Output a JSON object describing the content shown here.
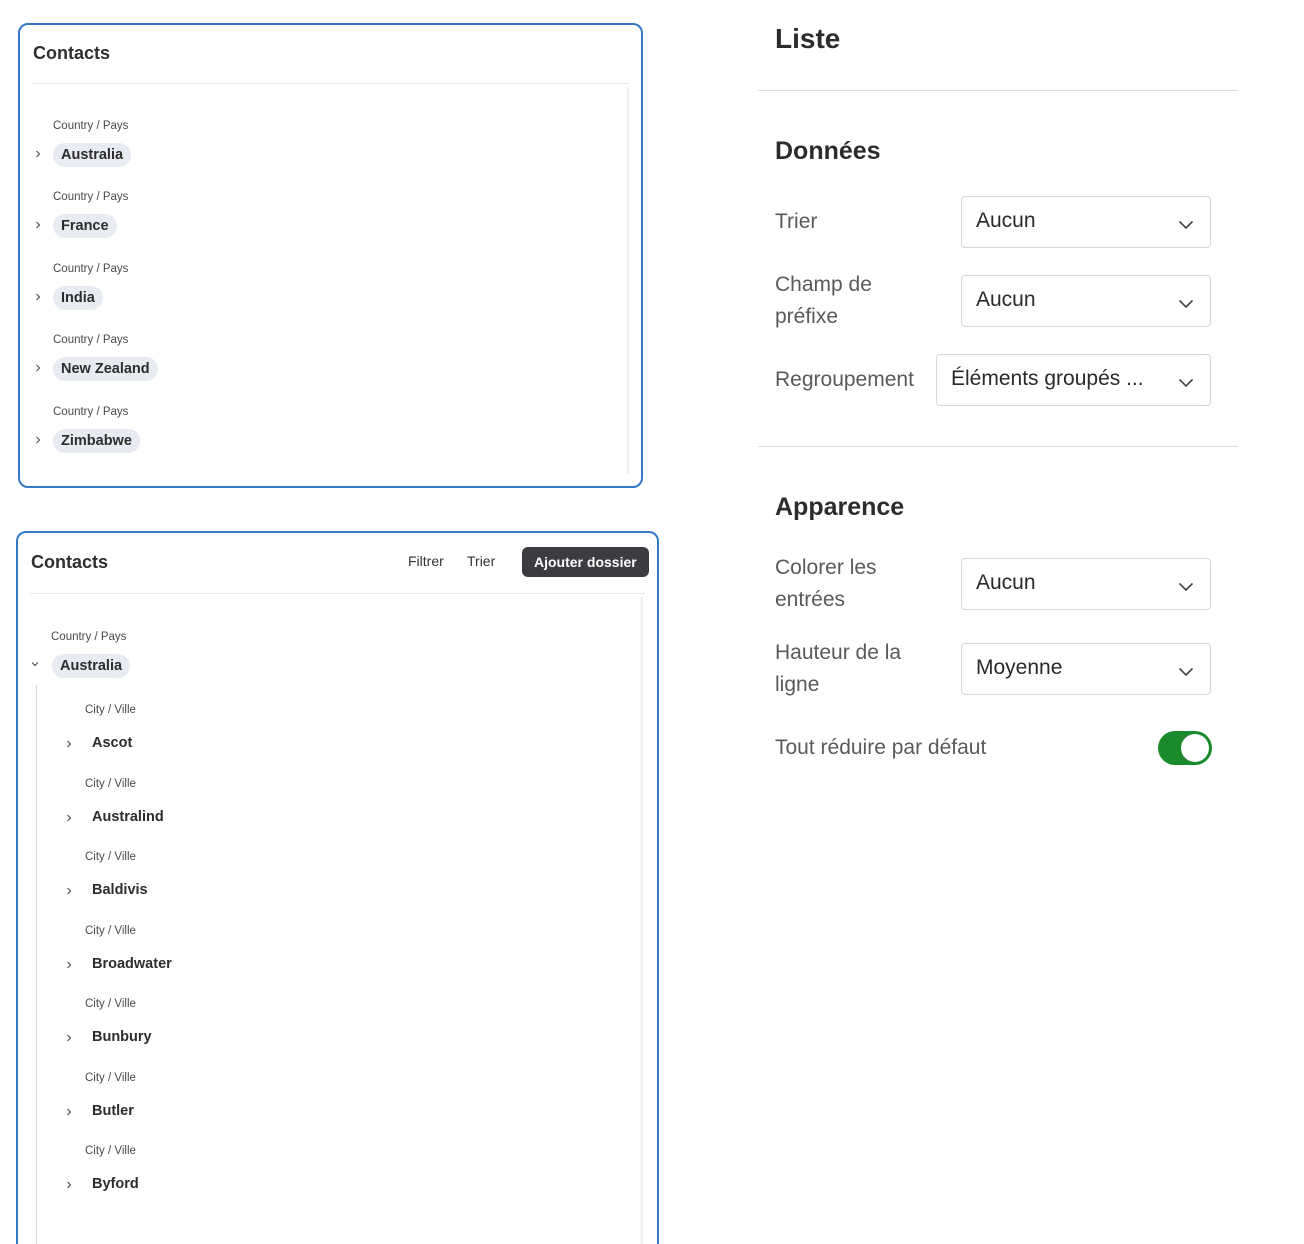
{
  "card_top": {
    "title": "Contacts",
    "groups": [
      {
        "label": "Country / Pays",
        "value": "Australia"
      },
      {
        "label": "Country / Pays",
        "value": "France"
      },
      {
        "label": "Country / Pays",
        "value": "India"
      },
      {
        "label": "Country / Pays",
        "value": "New Zealand"
      },
      {
        "label": "Country / Pays",
        "value": "Zimbabwe"
      }
    ]
  },
  "card_bottom": {
    "title": "Contacts",
    "filter_label": "Filtrer",
    "sort_label": "Trier",
    "add_folder_label": "Ajouter dossier",
    "country": {
      "label": "Country / Pays",
      "value": "Australia"
    },
    "cities": [
      {
        "label": "City / Ville",
        "value": "Ascot"
      },
      {
        "label": "City / Ville",
        "value": "Australind"
      },
      {
        "label": "City / Ville",
        "value": "Baldivis"
      },
      {
        "label": "City / Ville",
        "value": "Broadwater"
      },
      {
        "label": "City / Ville",
        "value": "Bunbury"
      },
      {
        "label": "City / Ville",
        "value": "Butler"
      },
      {
        "label": "City / Ville",
        "value": "Byford"
      }
    ]
  },
  "panel": {
    "title": "Liste",
    "data_section": {
      "title": "Données",
      "sort": {
        "label": "Trier",
        "value": "Aucun"
      },
      "prefix_field": {
        "label_line1": "Champ de",
        "label_line2": "préfixe",
        "value": "Aucun"
      },
      "grouping": {
        "label": "Regroupement",
        "value": "Éléments groupés ..."
      }
    },
    "appearance_section": {
      "title": "Apparence",
      "color_entries": {
        "label_line1": "Colorer les",
        "label_line2": "entrées",
        "value": "Aucun"
      },
      "row_height": {
        "label_line1": "Hauteur de la",
        "label_line2": "ligne",
        "value": "Moyenne"
      },
      "collapse_all": {
        "label": "Tout réduire par défaut",
        "enabled": true
      }
    }
  },
  "colors": {
    "accent_border": "#3478c6",
    "toggle_on": "#1a8a2c",
    "primary_button": "#3a3c40"
  }
}
